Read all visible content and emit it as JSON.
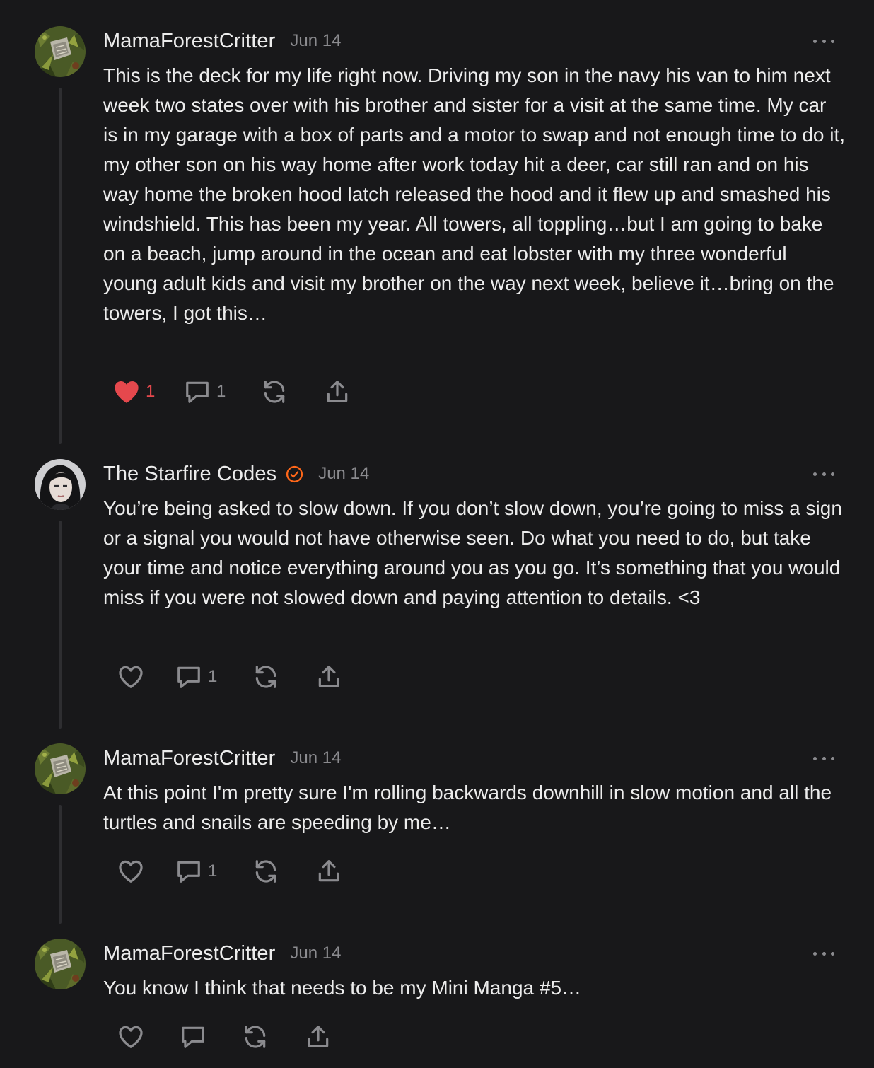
{
  "comments": [
    {
      "author": "MamaForestCritter",
      "date": "Jun 14",
      "verified": false,
      "avatar": "forest-avatar",
      "text": "This is the deck for my life right now. Driving my son in the navy his van to him next week two states over with his brother and sister for a visit at the same time. My car is in my garage with a box of parts and a motor to swap and not enough time to do it, my other son on his way home after work today hit a deer, car still ran and on his way home the broken hood latch released the hood and it flew up and smashed his windshield. This has been my year. All towers, all toppling…but I am going to bake on a beach, jump around in the ocean and eat lobster with my three wonderful young adult kids and visit my brother on the way next week, believe it…bring on the towers, I got this…",
      "likes": "1",
      "liked": true,
      "replies": "1"
    },
    {
      "author": "The Starfire Codes",
      "date": "Jun 14",
      "verified": true,
      "avatar": "portrait-avatar",
      "text": "You’re being asked to slow down. If you don’t slow down, you’re going to miss a sign or a signal you would not have otherwise seen. Do what you need to do, but take your time and notice everything around you as you go. It’s something that you would miss if you were not slowed down and paying attention to details. <3",
      "likes": "",
      "liked": false,
      "replies": "1"
    },
    {
      "author": "MamaForestCritter",
      "date": "Jun 14",
      "verified": false,
      "avatar": "forest-avatar",
      "text": "At this point I'm pretty sure I'm rolling backwards downhill in slow motion and all the turtles and snails are speeding by me…",
      "likes": "",
      "liked": false,
      "replies": "1"
    },
    {
      "author": "MamaForestCritter",
      "date": "Jun 14",
      "verified": false,
      "avatar": "forest-avatar",
      "text": "You know I think that needs to be my Mini Manga #5…",
      "likes": "",
      "liked": false,
      "replies": ""
    }
  ],
  "icons": {
    "like": "heart-icon",
    "reply": "comment-bubble-icon",
    "restack": "restack-arrows-icon",
    "share": "share-upload-icon",
    "more": "ellipsis-icon",
    "verified": "verified-check-icon"
  },
  "colors": {
    "background": "#18181a",
    "text": "#ececec",
    "muted": "#8b8b8f",
    "like": "#e5484d",
    "verified": "#ff6719"
  }
}
